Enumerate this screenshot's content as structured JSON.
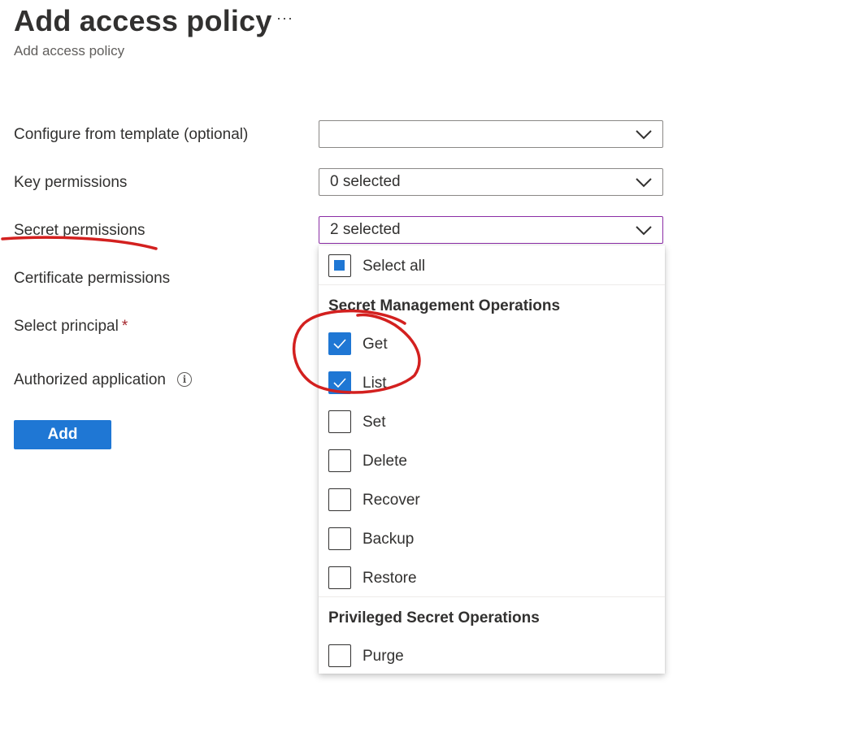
{
  "header": {
    "title": "Add access policy",
    "subtitle": "Add access policy",
    "more_label": "···"
  },
  "form": {
    "template_label": "Configure from template (optional)",
    "template_value": "",
    "key_label": "Key permissions",
    "key_value": "0 selected",
    "secret_label": "Secret permissions",
    "secret_value": "2 selected",
    "certificate_label": "Certificate permissions",
    "principal_label": "Select principal",
    "principal_required": "*",
    "authorized_label": "Authorized application",
    "add_label": "Add"
  },
  "dropdown": {
    "select_all": "Select all",
    "group1_title": "Secret Management Operations",
    "group2_title": "Privileged Secret Operations",
    "options": [
      {
        "label": "Get",
        "checked": true
      },
      {
        "label": "List",
        "checked": true
      },
      {
        "label": "Set",
        "checked": false
      },
      {
        "label": "Delete",
        "checked": false
      },
      {
        "label": "Recover",
        "checked": false
      },
      {
        "label": "Backup",
        "checked": false
      },
      {
        "label": "Restore",
        "checked": false
      },
      {
        "label": "Purge",
        "checked": false
      }
    ]
  },
  "icons": {
    "chevron": "chevron-down-icon",
    "info": "info-icon",
    "check": "checkmark-icon"
  },
  "colors": {
    "accent": "#1f77d4",
    "focus_border": "#8a2da5",
    "annotation": "#d3201f"
  }
}
